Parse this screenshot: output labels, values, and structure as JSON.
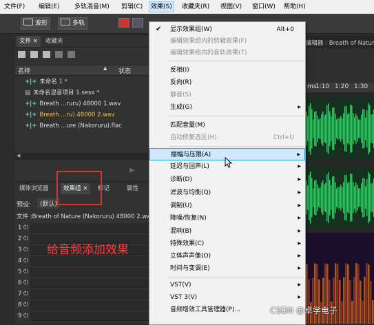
{
  "menubar": {
    "items": [
      "文件(F)",
      "编辑(E)",
      "多轨混音(M)",
      "剪辑(C)",
      "效果(S)",
      "收藏夹(R)",
      "视图(V)",
      "窗口(W)",
      "帮助(H)"
    ]
  },
  "toolbar": {
    "waveform_label": "波形",
    "multitrack_label": "多轨"
  },
  "file_panel": {
    "tabs": [
      "文件 ×",
      "收藏夹"
    ],
    "columns": {
      "name": "名称",
      "state": "状态"
    },
    "files": [
      "未命名 1 *",
      "未命名混音项目 1.sesx *",
      "Breath ...ruru) 48000 1.wav",
      "Breath ...ru) 48000 2.wav",
      "Breath ...ure (Nakoruru).flac"
    ]
  },
  "lower_panel": {
    "tabs": [
      "媒体浏览器",
      "效果组 ×",
      "标记",
      "属性"
    ],
    "preset_label": "预设:",
    "preset_value": "(默认)",
    "file_line": "文件 :Breath of Nature (Nakoruru) 48000 2.wa",
    "rows": [
      "1",
      "2",
      "3",
      "4",
      "5",
      "6",
      "7",
      "8",
      "9"
    ]
  },
  "annotation": "给音频添加效果",
  "right_panel": {
    "editor_title": "编辑器 : Breath of Nature",
    "ruler": [
      "ms",
      "1:10",
      "1:20",
      "1:30"
    ]
  },
  "effects_menu": {
    "items": [
      {
        "label": "显示效果组(W)",
        "shortcut": "Alt+0",
        "checked": true
      },
      {
        "label": "编辑效果组内的剪辑效果(F)",
        "disabled": true
      },
      {
        "label": "编辑效果组内的音轨效果(T)",
        "disabled": true
      },
      {
        "label": "反相(I)"
      },
      {
        "label": "反向(R)"
      },
      {
        "label": "静音(S)",
        "disabled": true
      },
      {
        "label": "生成(G)",
        "submenu": true
      },
      {
        "label": "匹配音量(M)"
      },
      {
        "label": "自动修复选区(H)",
        "shortcut": "Ctrl+U",
        "disabled": true
      },
      {
        "label": "振幅与压限(A)",
        "submenu": true,
        "highlighted": true
      },
      {
        "label": "延迟与回声(L)",
        "submenu": true
      },
      {
        "label": "诊断(D)",
        "submenu": true
      },
      {
        "label": "滤波与均衡(Q)",
        "submenu": true
      },
      {
        "label": "调制(U)",
        "submenu": true
      },
      {
        "label": "降噪/恢复(N)",
        "submenu": true
      },
      {
        "label": "混响(B)",
        "submenu": true
      },
      {
        "label": "特殊效果(C)",
        "submenu": true
      },
      {
        "label": "立体声声像(O)",
        "submenu": true
      },
      {
        "label": "时间与变调(E)",
        "submenu": true
      },
      {
        "label": "VST(V)",
        "submenu": true
      },
      {
        "label": "VST 3(V)",
        "submenu": true
      },
      {
        "label": "音频增效工具管理器(P)..."
      }
    ],
    "submenu_arrow": "▶",
    "check_glyph": "✔"
  },
  "watermark": "CSDN @卓学电子",
  "colors": {
    "accent_highlight": "#cde8ff",
    "annotation_red": "#e3302f",
    "wave_green": "#3fbf6a",
    "menu_bg": "#f2f2f2"
  }
}
